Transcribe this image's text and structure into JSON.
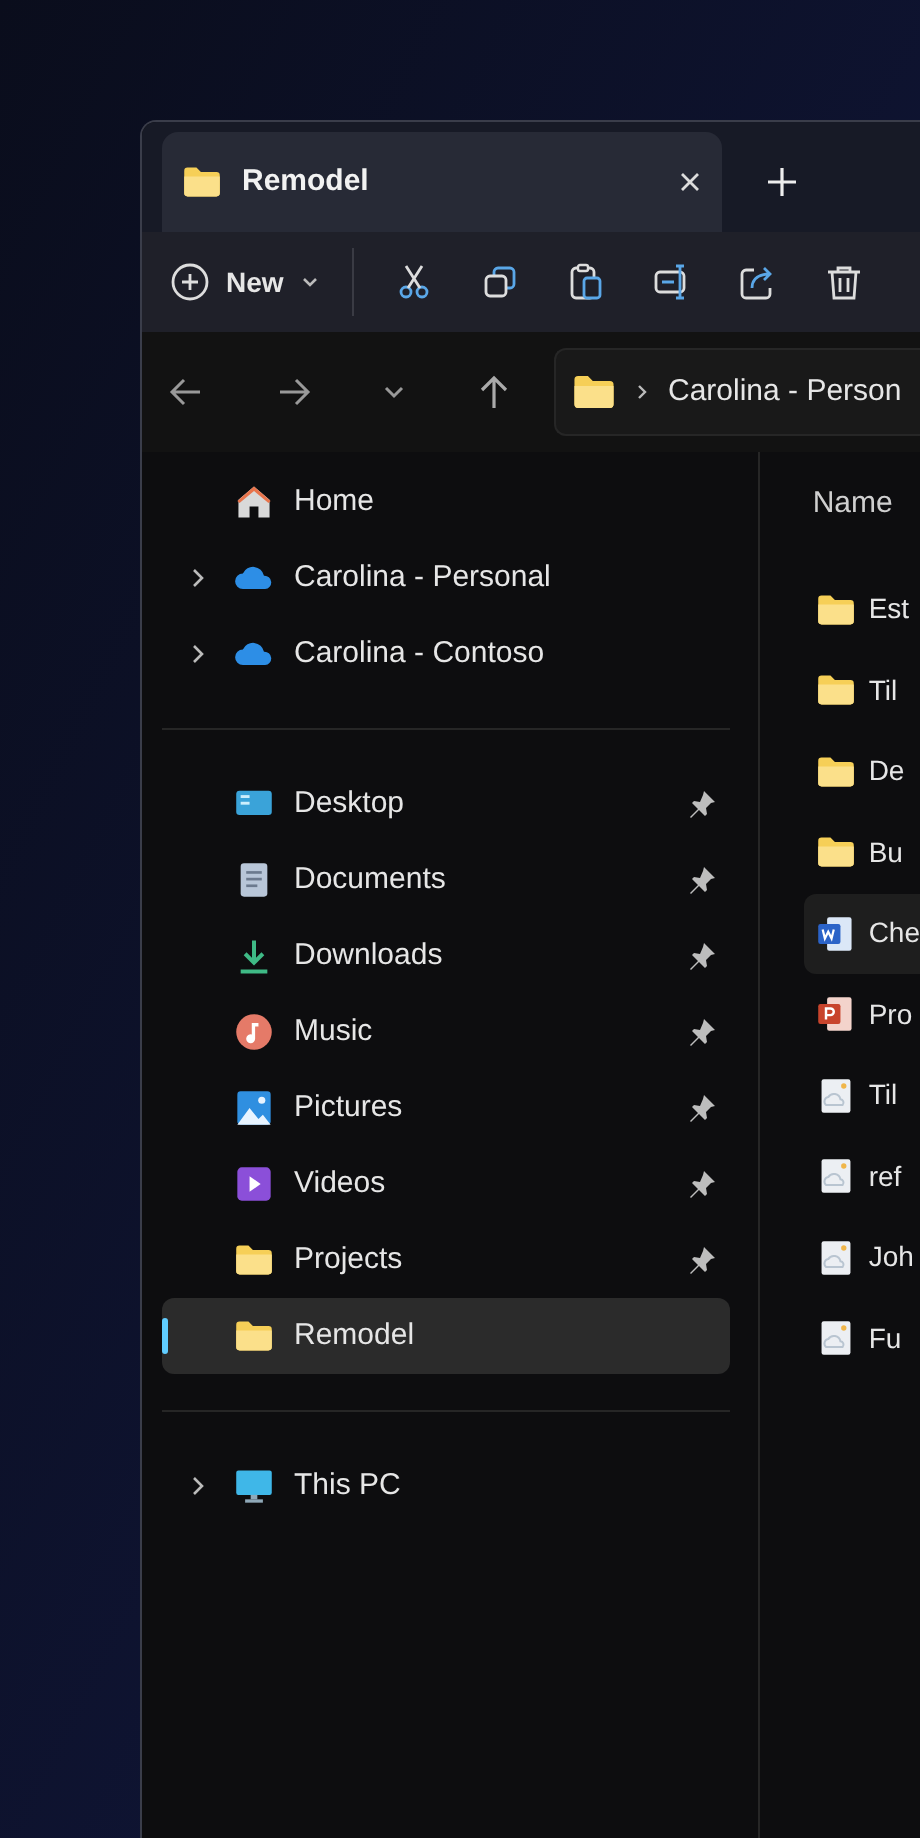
{
  "tab": {
    "title": "Remodel",
    "selected": true
  },
  "toolbar": {
    "new_label": "New"
  },
  "address": {
    "path": "Carolina - Person"
  },
  "sidebar": {
    "groups": [
      [
        {
          "label": "Home",
          "kind": "home",
          "expandable": false,
          "pinned": false,
          "selected": false
        },
        {
          "label": "Carolina - Personal",
          "kind": "cloud",
          "expandable": true,
          "pinned": false,
          "selected": false
        },
        {
          "label": "Carolina - Contoso",
          "kind": "cloud",
          "expandable": true,
          "pinned": false,
          "selected": false
        }
      ],
      [
        {
          "label": "Desktop",
          "kind": "desktop",
          "expandable": false,
          "pinned": true,
          "selected": false
        },
        {
          "label": "Documents",
          "kind": "documents",
          "expandable": false,
          "pinned": true,
          "selected": false
        },
        {
          "label": "Downloads",
          "kind": "downloads",
          "expandable": false,
          "pinned": true,
          "selected": false
        },
        {
          "label": "Music",
          "kind": "music",
          "expandable": false,
          "pinned": true,
          "selected": false
        },
        {
          "label": "Pictures",
          "kind": "pictures",
          "expandable": false,
          "pinned": true,
          "selected": false
        },
        {
          "label": "Videos",
          "kind": "videos",
          "expandable": false,
          "pinned": true,
          "selected": false
        },
        {
          "label": "Projects",
          "kind": "folder",
          "expandable": false,
          "pinned": true,
          "selected": false
        },
        {
          "label": "Remodel",
          "kind": "folder",
          "expandable": false,
          "pinned": false,
          "selected": true
        }
      ],
      [
        {
          "label": "This PC",
          "kind": "pc",
          "expandable": true,
          "pinned": false,
          "selected": false
        }
      ]
    ]
  },
  "files": {
    "columns": [
      "Name"
    ],
    "rows": [
      {
        "name": "Est",
        "kind": "folder",
        "selected": false
      },
      {
        "name": "Til",
        "kind": "folder",
        "selected": false
      },
      {
        "name": "De",
        "kind": "folder",
        "selected": false
      },
      {
        "name": "Bu",
        "kind": "folder",
        "selected": false
      },
      {
        "name": "Che",
        "kind": "word",
        "selected": true
      },
      {
        "name": "Pro",
        "kind": "powerpoint",
        "selected": false
      },
      {
        "name": "Til",
        "kind": "image",
        "selected": false
      },
      {
        "name": "ref",
        "kind": "image",
        "selected": false
      },
      {
        "name": "Joh",
        "kind": "image",
        "selected": false
      },
      {
        "name": "Fu",
        "kind": "image",
        "selected": false
      }
    ]
  }
}
